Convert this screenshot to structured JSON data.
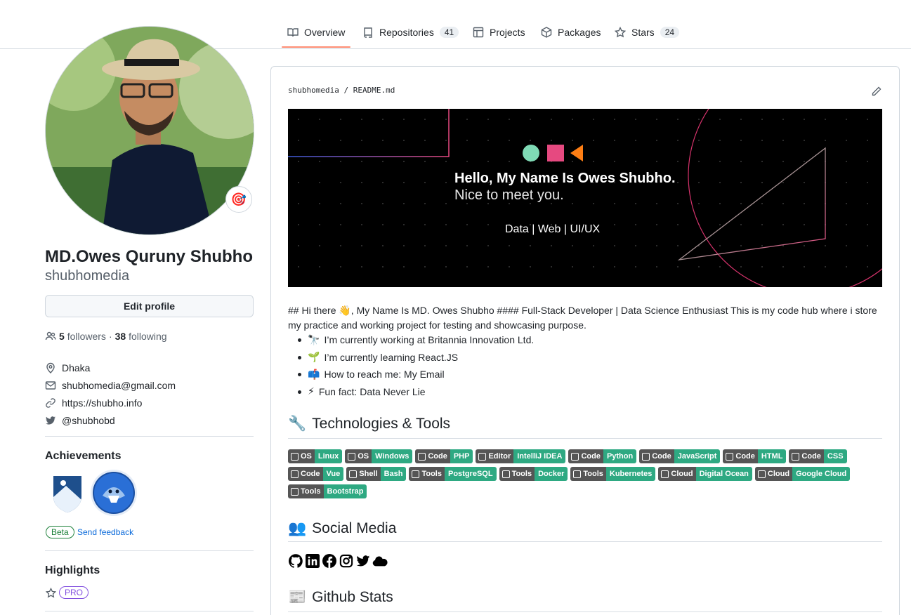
{
  "nav": {
    "tabs": [
      {
        "label": "Overview",
        "count": null
      },
      {
        "label": "Repositories",
        "count": "41"
      },
      {
        "label": "Projects",
        "count": null
      },
      {
        "label": "Packages",
        "count": null
      },
      {
        "label": "Stars",
        "count": "24"
      }
    ],
    "active_color": "#fd8c73"
  },
  "profile": {
    "full_name": "MD.Owes Quruny Shubho",
    "username": "shubhomedia",
    "edit_label": "Edit profile",
    "followers_count": "5",
    "followers_label": "followers",
    "separator": "·",
    "following_count": "38",
    "following_label": "following",
    "location": "Dhaka",
    "email": "shubhomedia@gmail.com",
    "website": "https://shubho.info",
    "twitter": "@shubhobd",
    "status_emoji": "🎯"
  },
  "achievements": {
    "title": "Achievements",
    "badges": [
      "arctic-code-vault-contributor",
      "quickdraw-shark"
    ],
    "beta_label": "Beta",
    "feedback_label": "Send feedback"
  },
  "highlights": {
    "title": "Highlights",
    "pro_label": "PRO"
  },
  "readme": {
    "path": "shubhomedia / README.md",
    "banner": {
      "hello": "Hello, My Name Is Owes Shubho.",
      "nice": "Nice to meet you.",
      "tags": "Data | Web | UI/UX"
    },
    "intro": "## Hi there 👋, My Name Is MD. Owes Shubho #### Full-Stack Developer | Data Science Enthusiast This is my code hub where i store my practice and working project for testing and showcasing purpose.",
    "bullets": [
      {
        "emoji": "🔭",
        "text": "I’m currently working at Britannia Innovation Ltd."
      },
      {
        "emoji": "🌱",
        "text": "I’m currently learning React.JS"
      },
      {
        "emoji": "📫",
        "text": "How to reach me: My Email"
      },
      {
        "emoji": "⚡",
        "text": "Fun fact: Data Never Lie"
      }
    ],
    "tech_title": "Technologies & Tools",
    "tech_emoji": "🔧",
    "badges": [
      {
        "label": "OS",
        "value": "Linux"
      },
      {
        "label": "OS",
        "value": "Windows"
      },
      {
        "label": "Code",
        "value": "PHP"
      },
      {
        "label": "Editor",
        "value": "IntelliJ IDEA"
      },
      {
        "label": "Code",
        "value": "Python"
      },
      {
        "label": "Code",
        "value": "JavaScript"
      },
      {
        "label": "Code",
        "value": "HTML"
      },
      {
        "label": "Code",
        "value": "CSS"
      },
      {
        "label": "Code",
        "value": "Vue"
      },
      {
        "label": "Shell",
        "value": "Bash"
      },
      {
        "label": "Tools",
        "value": "PostgreSQL"
      },
      {
        "label": "Tools",
        "value": "Docker"
      },
      {
        "label": "Tools",
        "value": "Kubernetes"
      },
      {
        "label": "Cloud",
        "value": "Digital Ocean"
      },
      {
        "label": "Cloud",
        "value": "Google Cloud"
      },
      {
        "label": "Tools",
        "value": "Bootstrap"
      }
    ],
    "social_title": "Social Media",
    "social_emoji": "👥",
    "social_icons": [
      "github-icon",
      "linkedin-icon",
      "facebook-icon",
      "instagram-icon",
      "twitter-icon",
      "cloud-icon"
    ],
    "stats_title": "Github Stats",
    "stats_emoji": "📰"
  }
}
